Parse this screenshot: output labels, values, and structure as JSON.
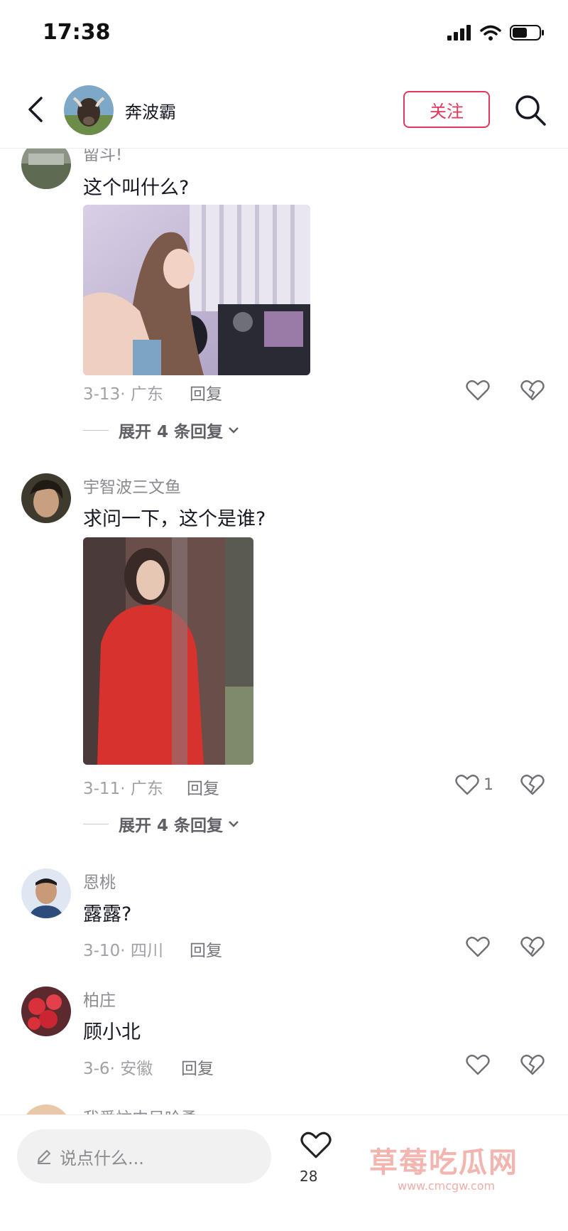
{
  "status_bar": {
    "time": "17:38"
  },
  "header": {
    "username": "奔波霸",
    "follow_label": "关注"
  },
  "comments": [
    {
      "name": "留斗!",
      "text": "这个叫什么?",
      "date_location": "3-13· 广东",
      "reply_label": "回复",
      "like_count": "",
      "expand_label": "展开 4 条回复"
    },
    {
      "name": "宇智波三文鱼",
      "text": "求问一下，这个是谁?",
      "date_location": "3-11· 广东",
      "reply_label": "回复",
      "like_count": "1",
      "expand_label": "展开 4 条回复"
    },
    {
      "name": "恩桃",
      "text": "露露?",
      "date_location": "3-10· 四川",
      "reply_label": "回复",
      "like_count": ""
    },
    {
      "name": "柏庄",
      "text": "顾小北",
      "date_location": "3-6· 安徽",
      "reply_label": "回复",
      "like_count": ""
    },
    {
      "name": "我爱忙内吴哈勇"
    }
  ],
  "bottom_bar": {
    "input_placeholder": "说点什么...",
    "like_count": "28",
    "watermark_text": "草莓吃瓜网",
    "watermark_url": "www.cmcgw.com"
  },
  "colors": {
    "accent": "#e0375a",
    "text": "#161823",
    "muted": "#8a8b91"
  },
  "icons": [
    "back-arrow-icon",
    "search-icon",
    "heart-icon",
    "broken-heart-icon",
    "pencil-icon",
    "chevron-down-icon",
    "signal-icon",
    "wifi-icon",
    "battery-icon"
  ]
}
